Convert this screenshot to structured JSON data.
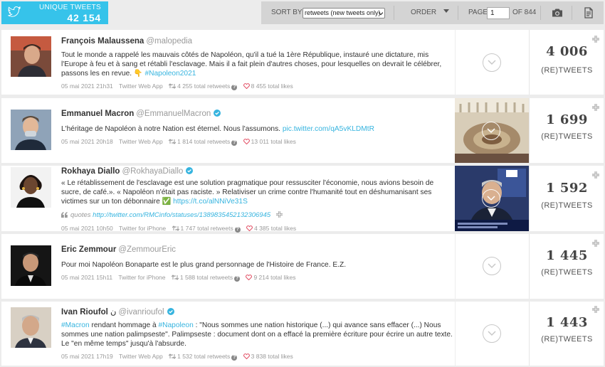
{
  "header": {
    "brand_label": "UNIQUE TWEETS",
    "brand_count": "42 154",
    "sort_label": "SORT BY",
    "sort_value": "retweets (new tweets only)",
    "order_label": "ORDER",
    "page_label": "PAGE",
    "page_value": "1",
    "page_of": "OF 844",
    "icons": [
      "twitter-bird-icon",
      "camera-icon",
      "document-icon"
    ]
  },
  "tweets": [
    {
      "name": "François Malaussena",
      "handle": "@malopedia",
      "verified": false,
      "text": "Tout le monde a rappelé les mauvais côtés de Napoléon, qu'il a tué la 1ère République, instauré une dictature, mis l'Europe à feu et à sang et rétabli l'esclavage. Mais il a fait plein d'autres choses, pour lesquelles on devrait le célébrer, passons les en revue. 👇",
      "link": "#Napoleon2021",
      "date": "05 mai 2021 21h31",
      "source": "Twitter Web App",
      "retweets": "4 255 total retweets",
      "likes": "8 455 total likes",
      "count": "4 006",
      "unit": "(RE)TWEETS"
    },
    {
      "name": "Emmanuel Macron",
      "handle": "@EmmanuelMacron",
      "verified": true,
      "text": "L'héritage de Napoléon à notre Nation est éternel. Nous l'assumons.",
      "link": "pic.twitter.com/qA5vKLDMtR",
      "date": "05 mai 2021 20h18",
      "source": "Twitter Web App",
      "retweets": "1 814 total retweets",
      "likes": "13 011 total likes",
      "count": "1 699",
      "unit": "(RE)TWEETS"
    },
    {
      "name": "Rokhaya Diallo",
      "handle": "@RokhayaDiallo",
      "verified": true,
      "text": "« Le rétablissement de l'esclavage est une solution pragmatique pour ressusciter l'économie, nous avions besoin de sucre, de café.». « Napoléon n'était pas raciste. » Relativiser un crime contre l'humanité tout en déshumanisant ses victimes sur un ton débonnaire ✅",
      "link": "https://t.co/alNNiVe31S",
      "quotes_label": "quotes",
      "quotes_link": "http://twitter.com/RMCinfo/statuses/1389835452132306945",
      "date": "05 mai 2021 10h50",
      "source": "Twitter for iPhone",
      "retweets": "1 747 total retweets",
      "likes": "4 385 total likes",
      "count": "1 592",
      "unit": "(RE)TWEETS"
    },
    {
      "name": "Eric Zemmour",
      "handle": "@ZemmourEric",
      "verified": false,
      "text": "Pour moi Napoléon Bonaparte est le plus grand personnage de l'Histoire de France. E.Z.",
      "link": "",
      "date": "05 mai 2021 15h11",
      "source": "Twitter for iPhone",
      "retweets": "1 588 total retweets",
      "likes": "9 214 total likes",
      "count": "1 445",
      "unit": "(RE)TWEETS"
    },
    {
      "name": "Ivan Rioufol",
      "name_suffix": "ن",
      "handle": "@ivanrioufol",
      "verified": true,
      "link_start": "#Macron",
      "text_mid1": " rendant hommage à ",
      "link_mid": "#Napoleon",
      "text_end": " : \"Nous sommes une nation historique (...) qui avance sans effacer (...) Nous sommes une nation palimpseste\". Palimpseste : document dont on a effacé la première écriture pour écrire un autre texte. Le \"en même temps\" jusqu'à l'absurde.",
      "date": "05 mai 2021 17h19",
      "source": "Twitter Web App",
      "retweets": "1 532 total retweets",
      "likes": "3 838 total likes",
      "count": "1 443",
      "unit": "(RE)TWEETS"
    }
  ]
}
